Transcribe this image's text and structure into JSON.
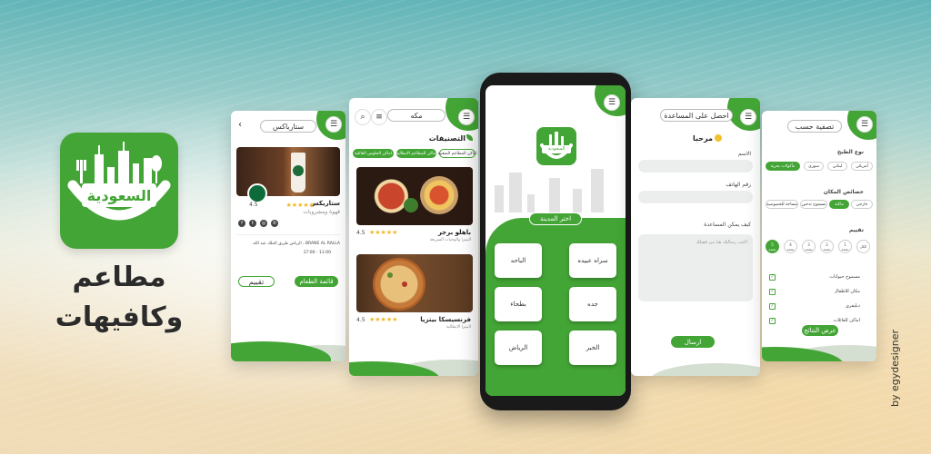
{
  "brand": {
    "logo_word": "السعودية",
    "tagline_line1": "مطاعم",
    "tagline_line2": "وكافيهات",
    "credit": "by egydesigner",
    "accent": "#43a535"
  },
  "screen_detail": {
    "title": "ستارباكس",
    "shop_name": "ستاربكس",
    "shop_sub": "قهوة ومشروبات",
    "rating": "4.5",
    "address": "BRANE AL RALLA ، الرياض طريق الملك عبد الله",
    "hours": "11:00 - 17:00",
    "phone_label": "تقييم",
    "menu_button": "قائمة الطعام",
    "rate_button": "تقييم",
    "social_icons": [
      "facebook-icon",
      "twitter-icon",
      "instagram-icon",
      "whatsapp-icon"
    ]
  },
  "screen_categories": {
    "city": "مكه",
    "section_title": "التصنيفات",
    "chips": [
      "اماكن الجلوس العائلية",
      "اماكن المطاعم الايطالية",
      "اماكن المطاعم الشعبية"
    ],
    "items": [
      {
        "name": "باهلو برجر",
        "sub": "البيتزا والوجبات السريعة",
        "rating": "4.5"
      },
      {
        "name": "فرنسيسكا بيتزيا",
        "sub": "البيتزا الايطالية",
        "rating": "4.5"
      }
    ]
  },
  "screen_city": {
    "logo_word": "السعودية",
    "choose_label": "اختر المدينة",
    "cities": [
      "سراه عبيده",
      "الباحه",
      "جده",
      "بطحاء",
      "الخبر",
      "الرياض"
    ]
  },
  "screen_help": {
    "title": "احصل على المساعدة",
    "greeting": "مرحبا",
    "name_label": "الاسم",
    "phone_label": "رقم الهاتف",
    "question_label": "كيف يمكن المساعدة",
    "message_placeholder": "اكتب رسالتك هنا من فضلك",
    "send_button": "ارسال"
  },
  "screen_filter": {
    "title": "تصفية حسب",
    "cuisine_label": "نوع الطبخ",
    "cuisines": [
      "مأكولات بحرية",
      "سوري",
      "لبناني",
      "أمريكي"
    ],
    "place_label": "خصائص المكان",
    "places": [
      "مساحة للخصوصية",
      "مسموح تدخين",
      "ماكنة",
      "خارجي"
    ],
    "rating_label": "تقييم",
    "ratings": [
      {
        "n": "5",
        "t": "نجمة"
      },
      {
        "n": "4",
        "t": "نجمة"
      },
      {
        "n": "3",
        "t": "نجمة"
      },
      {
        "n": "2",
        "t": "نجمة"
      },
      {
        "n": "1",
        "t": "نجمة"
      },
      {
        "n": "",
        "t": "الكل"
      }
    ],
    "options": [
      "مسموح حيوانات",
      "مكان للاطفال",
      "ديليفري",
      "اماكن للعائلات"
    ],
    "submit_button": "عرض النتائج"
  }
}
